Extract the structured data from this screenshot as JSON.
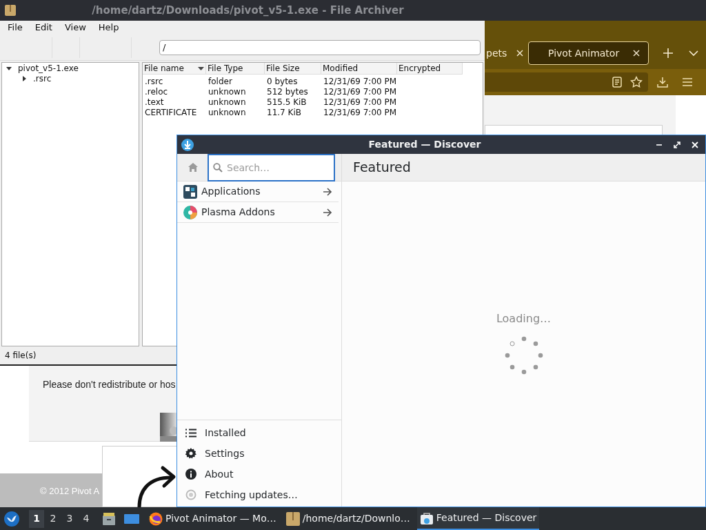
{
  "browser": {
    "tabs": [
      {
        "label": "pets",
        "selected": false
      },
      {
        "label": "Pivot Animator",
        "selected": true
      }
    ],
    "notice": "Please don't redistribute or hos",
    "footer": "© 2012 Pivot A"
  },
  "archiver": {
    "title": "/home/dartz/Downloads/pivot_v5-1.exe - File Archiver",
    "menu": [
      "File",
      "Edit",
      "View",
      "Help"
    ],
    "path": "/",
    "tree": [
      {
        "label": "pivot_v5-1.exe",
        "expanded": true,
        "children": [
          {
            "label": ".rsrc",
            "expanded": false
          }
        ]
      }
    ],
    "columns": [
      "File name",
      "File Type",
      "File Size",
      "Modified",
      "Encrypted"
    ],
    "rows": [
      [
        ".rsrc",
        "folder",
        "0 bytes",
        "12/31/69 7:00 PM"
      ],
      [
        ".reloc",
        "unknown",
        "512 bytes",
        "12/31/69 7:00 PM"
      ],
      [
        ".text",
        "unknown",
        "515.5 KiB",
        "12/31/69 7:00 PM"
      ],
      [
        "CERTIFICATE",
        "unknown",
        "11.7 KiB",
        "12/31/69 7:00 PM"
      ]
    ],
    "status": "4 file(s)"
  },
  "discover": {
    "title": "Featured — Discover",
    "search": {
      "placeholder": "Search…"
    },
    "categories": [
      {
        "kind": "apps",
        "label": "Applications"
      },
      {
        "kind": "addons",
        "label": "Plasma Addons"
      }
    ],
    "heading": "Featured",
    "loading": "Loading…",
    "nav": [
      {
        "kind": "installed",
        "label": "Installed"
      },
      {
        "kind": "settings",
        "label": "Settings"
      },
      {
        "kind": "about",
        "label": "About"
      },
      {
        "kind": "updates",
        "label": "Fetching updates…"
      }
    ]
  },
  "taskbar": {
    "desktops": [
      {
        "label": "1",
        "selected": true
      },
      {
        "label": "2",
        "selected": false
      },
      {
        "label": "3",
        "selected": false
      },
      {
        "label": "4",
        "selected": false
      }
    ],
    "tasks": [
      {
        "kind": "firefox",
        "label": "Pivot Animator — Mo…",
        "selected": false
      },
      {
        "kind": "archive",
        "label": "/home/dartz/Downlo…",
        "selected": false
      },
      {
        "kind": "discover",
        "label": "Featured — Discover",
        "selected": true
      }
    ]
  }
}
